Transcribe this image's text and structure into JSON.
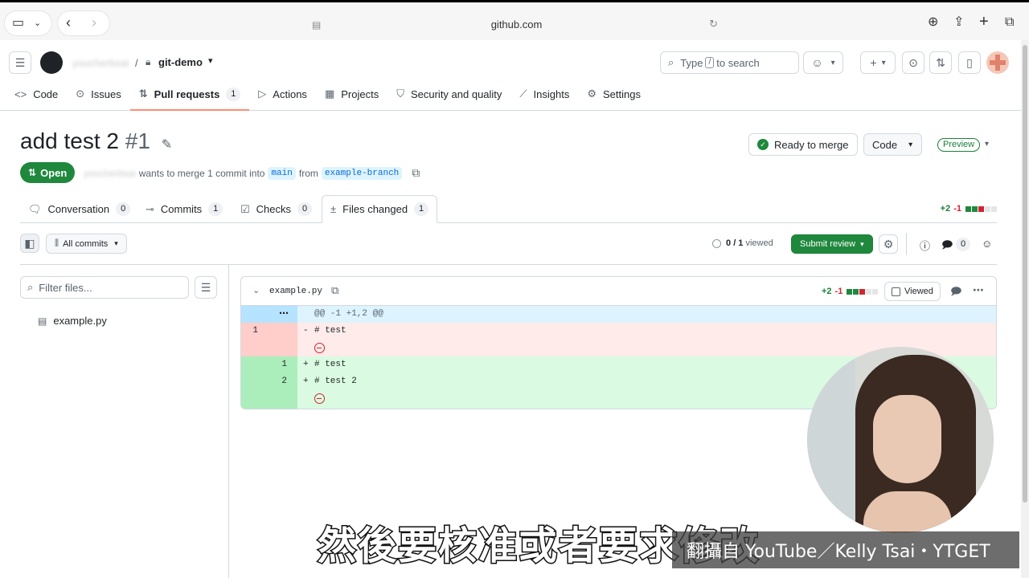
{
  "browser": {
    "url": "github.com"
  },
  "header": {
    "owner": "youcherbsai",
    "repo": "git-demo",
    "search_placeholder_pre": "Type",
    "search_key": "/",
    "search_placeholder_post": "to search"
  },
  "repo_tabs": [
    {
      "label": "Code",
      "icon": "code-icon"
    },
    {
      "label": "Issues",
      "icon": "issue-icon"
    },
    {
      "label": "Pull requests",
      "icon": "pull-request-icon",
      "count": "1"
    },
    {
      "label": "Actions",
      "icon": "play-icon"
    },
    {
      "label": "Projects",
      "icon": "table-icon"
    },
    {
      "label": "Security and quality",
      "icon": "shield-icon"
    },
    {
      "label": "Insights",
      "icon": "graph-icon"
    },
    {
      "label": "Settings",
      "icon": "gear-icon"
    }
  ],
  "pr": {
    "title": "add test 2",
    "number": "#1",
    "state": "Open",
    "author": "youcherbsai",
    "merge_text": "wants to merge 1 commit into",
    "base": "main",
    "from": "from",
    "head": "example-branch",
    "ready_label": "Ready to merge",
    "code_label": "Code",
    "preview_label": "Preview"
  },
  "pr_tabs": [
    {
      "label": "Conversation",
      "count": "0"
    },
    {
      "label": "Commits",
      "count": "1"
    },
    {
      "label": "Checks",
      "count": "0"
    },
    {
      "label": "Files changed",
      "count": "1"
    }
  ],
  "diffstat": {
    "add": "+2",
    "del": "-1"
  },
  "toolbar": {
    "all_commits": "All commits",
    "viewed_count": "0",
    "viewed_total": "/ 1",
    "viewed_label": "viewed",
    "submit_label": "Submit review",
    "comments_count": "0"
  },
  "filetree": {
    "filter_placeholder": "Filter files...",
    "files": [
      "example.py"
    ]
  },
  "diff": {
    "filename": "example.py",
    "add": "+2",
    "del": "-1",
    "viewed_label": "Viewed",
    "hunk": "@@ -1 +1,2 @@",
    "lines": [
      {
        "type": "del",
        "old": "1",
        "new": "",
        "sign": "-",
        "text": "# test"
      },
      {
        "type": "add",
        "old": "",
        "new": "1",
        "sign": "+",
        "text": "# test"
      },
      {
        "type": "add",
        "old": "",
        "new": "2",
        "sign": "+",
        "text": "# test 2"
      }
    ]
  },
  "overlay": {
    "subtitle": "然後要核准或者要求修改",
    "credit": "翻攝自 YouTube／Kelly Tsai・YTGET"
  },
  "colors": {
    "accent_green": "#1f883d",
    "del_bg": "#ffebe9",
    "add_bg": "#dafbe1",
    "hunk_bg": "#ddf4ff"
  }
}
